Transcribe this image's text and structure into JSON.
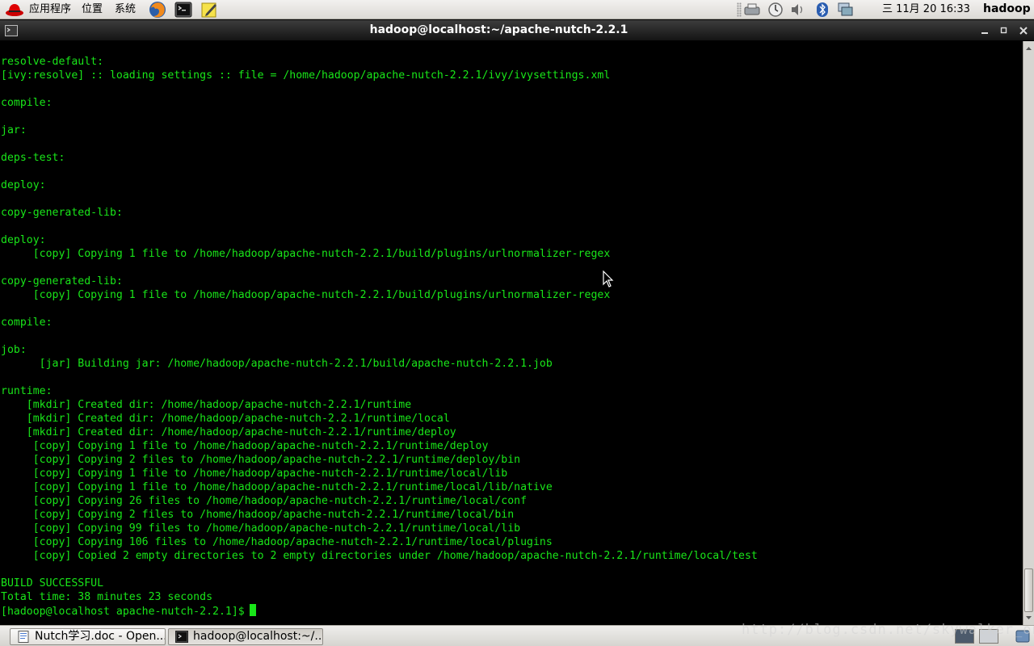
{
  "top_panel": {
    "menus": [
      "应用程序",
      "位置",
      "系统"
    ],
    "clock": "三 11月 20 16:33",
    "user": "hadoop"
  },
  "window": {
    "title": "hadoop@localhost:~/apache-nutch-2.2.1"
  },
  "terminal": {
    "lines": [
      "resolve-default:",
      "[ivy:resolve] :: loading settings :: file = /home/hadoop/apache-nutch-2.2.1/ivy/ivysettings.xml",
      "",
      "compile:",
      "",
      "jar:",
      "",
      "deps-test:",
      "",
      "deploy:",
      "",
      "copy-generated-lib:",
      "",
      "deploy:",
      "     [copy] Copying 1 file to /home/hadoop/apache-nutch-2.2.1/build/plugins/urlnormalizer-regex",
      "",
      "copy-generated-lib:",
      "     [copy] Copying 1 file to /home/hadoop/apache-nutch-2.2.1/build/plugins/urlnormalizer-regex",
      "",
      "compile:",
      "",
      "job:",
      "      [jar] Building jar: /home/hadoop/apache-nutch-2.2.1/build/apache-nutch-2.2.1.job",
      "",
      "runtime:",
      "    [mkdir] Created dir: /home/hadoop/apache-nutch-2.2.1/runtime",
      "    [mkdir] Created dir: /home/hadoop/apache-nutch-2.2.1/runtime/local",
      "    [mkdir] Created dir: /home/hadoop/apache-nutch-2.2.1/runtime/deploy",
      "     [copy] Copying 1 file to /home/hadoop/apache-nutch-2.2.1/runtime/deploy",
      "     [copy] Copying 2 files to /home/hadoop/apache-nutch-2.2.1/runtime/deploy/bin",
      "     [copy] Copying 1 file to /home/hadoop/apache-nutch-2.2.1/runtime/local/lib",
      "     [copy] Copying 1 file to /home/hadoop/apache-nutch-2.2.1/runtime/local/lib/native",
      "     [copy] Copying 26 files to /home/hadoop/apache-nutch-2.2.1/runtime/local/conf",
      "     [copy] Copying 2 files to /home/hadoop/apache-nutch-2.2.1/runtime/local/bin",
      "     [copy] Copying 99 files to /home/hadoop/apache-nutch-2.2.1/runtime/local/lib",
      "     [copy] Copying 106 files to /home/hadoop/apache-nutch-2.2.1/runtime/local/plugins",
      "     [copy] Copied 2 empty directories to 2 empty directories under /home/hadoop/apache-nutch-2.2.1/runtime/local/test",
      "",
      "BUILD SUCCESSFUL",
      "Total time: 38 minutes 23 seconds"
    ],
    "prompt": "[hadoop@localhost apache-nutch-2.2.1]$",
    "text_color": "#19e619",
    "background": "#000000"
  },
  "taskbar": {
    "tasks": [
      {
        "label": "Nutch学习.doc - Open...",
        "icon": "document-icon"
      },
      {
        "label": "hadoop@localhost:~/...",
        "icon": "terminal-icon"
      }
    ]
  },
  "watermark": "http://blog.csdn.net/skywalker_only"
}
